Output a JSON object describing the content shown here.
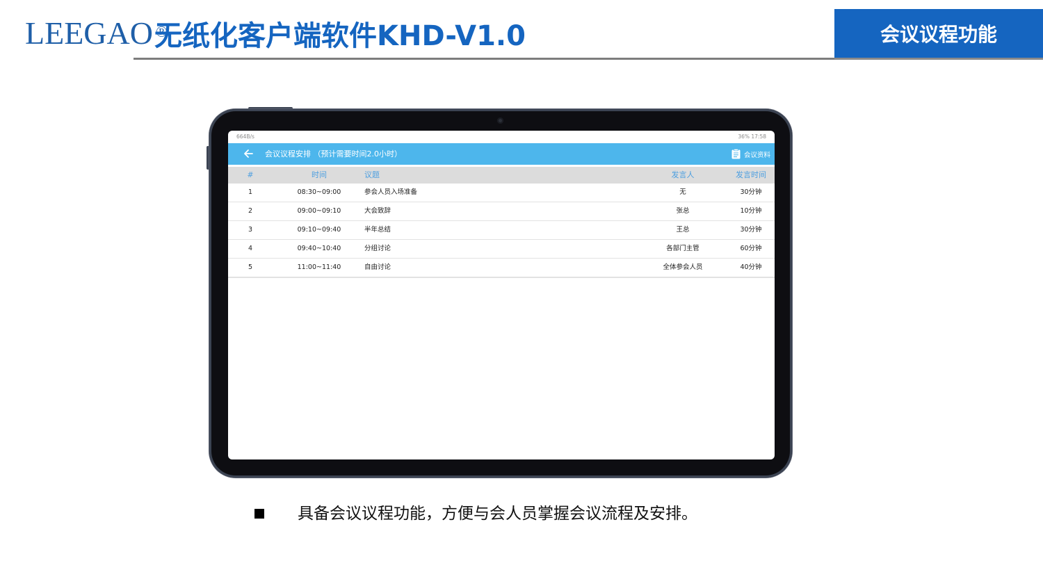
{
  "header": {
    "logo": "LEEGAO",
    "logo_mark": "®",
    "title": "无纸化客户端软件KHD-V1.0",
    "section": "会议议程功能"
  },
  "device": {
    "status": {
      "left": "664B/s",
      "right": "36% 17:58"
    },
    "app_bar": {
      "back_icon": "arrow-left-icon",
      "title": "会议议程安排 （预计需要时间2.0小时）",
      "docs_icon": "clipboard-icon",
      "docs_label": "会议资料"
    },
    "table": {
      "headers": {
        "num": "#",
        "time": "时间",
        "topic": "议题",
        "speaker": "发言人",
        "duration": "发言时间"
      },
      "rows": [
        {
          "num": "1",
          "time": "08:30~09:00",
          "topic": "参会人员入场准备",
          "speaker": "无",
          "duration": "30分钟"
        },
        {
          "num": "2",
          "time": "09:00~09:10",
          "topic": "大会致辞",
          "speaker": "张总",
          "duration": "10分钟"
        },
        {
          "num": "3",
          "time": "09:10~09:40",
          "topic": "半年总结",
          "speaker": "王总",
          "duration": "30分钟"
        },
        {
          "num": "4",
          "time": "09:40~10:40",
          "topic": "分组讨论",
          "speaker": "各部门主管",
          "duration": "60分钟"
        },
        {
          "num": "5",
          "time": "11:00~11:40",
          "topic": "自由讨论",
          "speaker": "全体参会人员",
          "duration": "40分钟"
        }
      ]
    },
    "colors": {
      "app_bar": "#4db6ec",
      "header_text": "#4d9fe0",
      "brand": "#1565c0"
    }
  },
  "caption": {
    "text": "具备会议议程功能，方便与会人员掌握会议流程及安排。"
  }
}
